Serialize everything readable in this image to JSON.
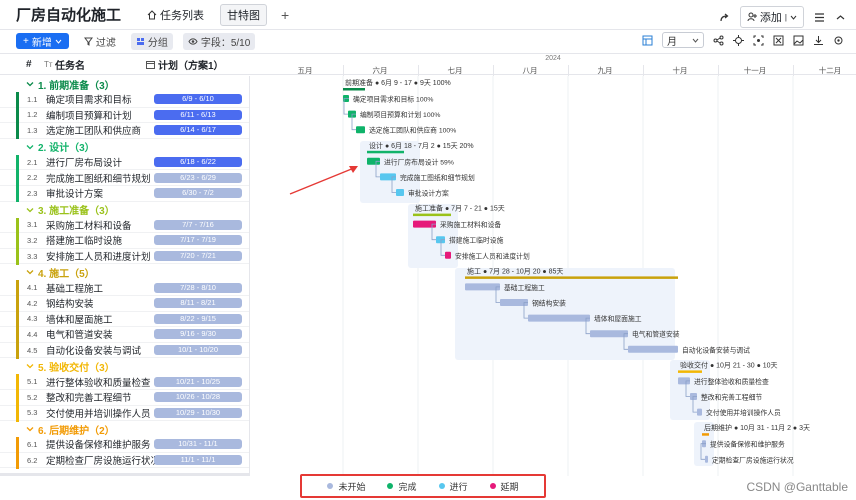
{
  "app": {
    "title": "厂房自动化施工"
  },
  "tabs": [
    {
      "label": "任务列表",
      "icon": "home-icon"
    },
    {
      "label": "甘特图",
      "active": true
    },
    {
      "label": "+"
    }
  ],
  "top_right": {
    "add_label": "添加"
  },
  "toolbar": {
    "new_label": "新增",
    "filter_label": "过滤",
    "group_label": "分组",
    "fields_label": "字段：5/10",
    "scale_label": "月"
  },
  "grid_header": {
    "index": "#",
    "name": "任务名",
    "plan": "计划（方案1）"
  },
  "timeline": {
    "year": "2024",
    "months": [
      "五月",
      "六月",
      "七月",
      "八月",
      "九月",
      "十月",
      "十一月",
      "十二月"
    ]
  },
  "colors": {
    "primary": "#1a6ef2",
    "done": "#0fb36a",
    "doing": "#58c7ef",
    "todo": "#a9b9de",
    "delayed": "#e6197a"
  },
  "groups": [
    {
      "label": "1. 前期准备（3）",
      "color": "#0a8a4a",
      "summary": "前期准备 ● 6月 9 - 17 ● 9天 100%",
      "tasks": [
        {
          "num": "1.1",
          "name": "确定项目需求和目标",
          "plan": "6/9 - 6/10",
          "pill": "#4b6cf0",
          "label": "确定项目需求和目标 100%"
        },
        {
          "num": "1.2",
          "name": "编制项目预算和计划",
          "plan": "6/11 - 6/13",
          "pill": "#4b6cf0",
          "label": "编制项目预算和计划 100%"
        },
        {
          "num": "1.3",
          "name": "选定施工团队和供应商",
          "plan": "6/14 - 6/17",
          "pill": "#4b6cf0",
          "label": "选定施工团队和供应商 100%"
        }
      ]
    },
    {
      "label": "2. 设计（3）",
      "color": "#12b36a",
      "summary": "设计 ● 6月 18 - 7月 2 ● 15天 20%",
      "tasks": [
        {
          "num": "2.1",
          "name": "进行厂房布局设计",
          "plan": "6/18 - 6/22",
          "pill": "#4b6cf0",
          "label": "进行厂房布局设计 59%"
        },
        {
          "num": "2.2",
          "name": "完成施工图纸和细节规划",
          "plan": "6/23 - 6/29",
          "pill": "#a9b9de",
          "label": "完成施工图纸和细节规划"
        },
        {
          "num": "2.3",
          "name": "审批设计方案",
          "plan": "6/30 - 7/2",
          "pill": "#a9b9de",
          "label": "审批设计方案"
        }
      ]
    },
    {
      "label": "3. 施工准备（3）",
      "color": "#9ac21a",
      "summary": "施工准备 ● 7月 7 - 21 ● 15天",
      "tasks": [
        {
          "num": "3.1",
          "name": "采购施工材料和设备",
          "plan": "7/7 - 7/16",
          "pill": "#a9b9de",
          "label": "采购施工材料和设备"
        },
        {
          "num": "3.2",
          "name": "搭建施工临时设施",
          "plan": "7/17 - 7/19",
          "pill": "#a9b9de",
          "label": "搭建施工临时设施"
        },
        {
          "num": "3.3",
          "name": "安排施工人员和进度计划",
          "plan": "7/20 - 7/21",
          "pill": "#a9b9de",
          "label": "安排施工人员和进度计划"
        }
      ]
    },
    {
      "label": "4. 施工（5）",
      "color": "#c9a20d",
      "summary": "施工 ● 7月 28 - 10月 20 ● 85天",
      "tasks": [
        {
          "num": "4.1",
          "name": "基础工程施工",
          "plan": "7/28 - 8/10",
          "pill": "#a9b9de",
          "label": "基础工程施工"
        },
        {
          "num": "4.2",
          "name": "钢结构安装",
          "plan": "8/11 - 8/21",
          "pill": "#a9b9de",
          "label": "钢结构安装"
        },
        {
          "num": "4.3",
          "name": "墙体和屋面施工",
          "plan": "8/22 - 9/15",
          "pill": "#a9b9de",
          "label": "墙体和屋面施工"
        },
        {
          "num": "4.4",
          "name": "电气和管道安装",
          "plan": "9/16 - 9/30",
          "pill": "#a9b9de",
          "label": "电气和管道安装"
        },
        {
          "num": "4.5",
          "name": "自动化设备安装与调试",
          "plan": "10/1 - 10/20",
          "pill": "#a9b9de",
          "label": "自动化设备安装与调试"
        }
      ]
    },
    {
      "label": "5. 验收交付（3）",
      "color": "#f2b705",
      "summary": "验收交付 ● 10月 21 - 30 ● 10天",
      "tasks": [
        {
          "num": "5.1",
          "name": "进行整体验收和质量检查",
          "plan": "10/21 - 10/25",
          "pill": "#a9b9de",
          "label": "进行整体验收和质量检查"
        },
        {
          "num": "5.2",
          "name": "整改和完善工程细节",
          "plan": "10/26 - 10/28",
          "pill": "#a9b9de",
          "label": "整改和完善工程细节"
        },
        {
          "num": "5.3",
          "name": "交付使用并培训操作人员",
          "plan": "10/29 - 10/30",
          "pill": "#a9b9de",
          "label": "交付使用并培训操作人员"
        }
      ]
    },
    {
      "label": "6. 后期维护（2）",
      "color": "#f29b05",
      "summary": "后期维护 ● 10月 31 - 11月 2 ● 3天",
      "tasks": [
        {
          "num": "6.1",
          "name": "提供设备保修和维护服务",
          "plan": "10/31 - 11/1",
          "pill": "#a9b9de",
          "label": "提供设备保修和维护服务"
        },
        {
          "num": "6.2",
          "name": "定期检查厂房设施运行状况",
          "plan": "11/1 - 11/1",
          "pill": "#a9b9de",
          "label": "定期检查厂房设施运行状况"
        }
      ]
    }
  ],
  "legend": [
    {
      "label": "未开始",
      "color": "#a9b9de"
    },
    {
      "label": "完成",
      "color": "#0fb36a"
    },
    {
      "label": "进行",
      "color": "#58c7ef"
    },
    {
      "label": "延期",
      "color": "#e6197a"
    }
  ],
  "watermark": "CSDN @Ganttable"
}
